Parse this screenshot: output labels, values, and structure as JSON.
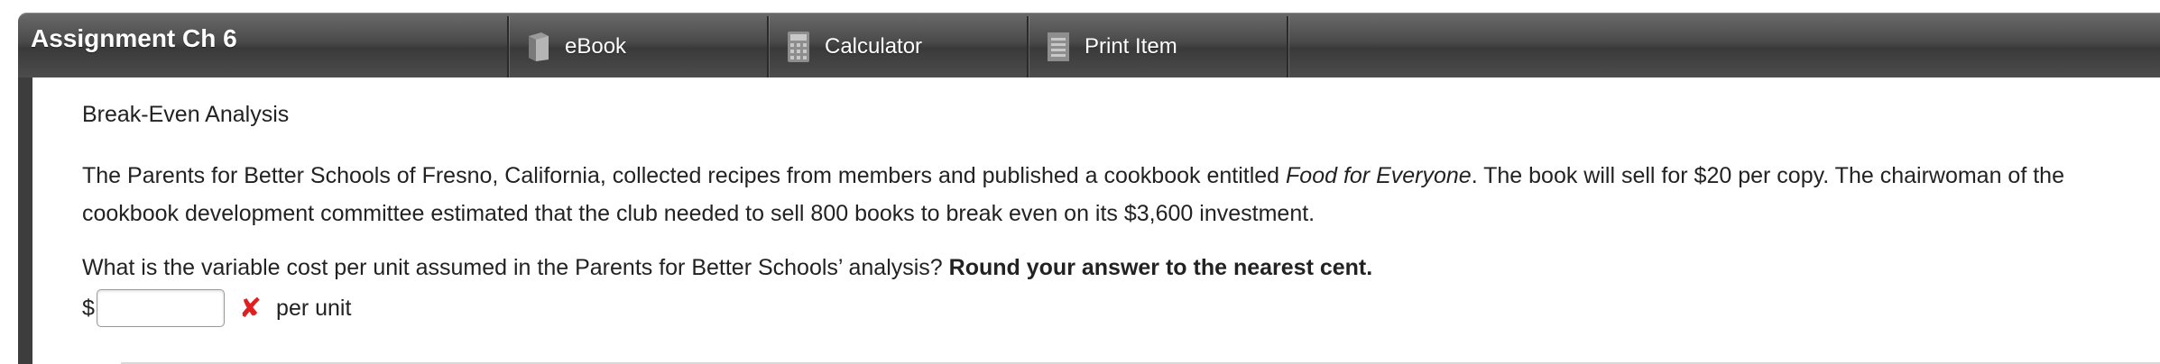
{
  "toolbar": {
    "title": "Assignment Ch 6",
    "buttons": [
      {
        "label": "eBook",
        "icon": "book-icon"
      },
      {
        "label": "Calculator",
        "icon": "calculator-icon"
      },
      {
        "label": "Print Item",
        "icon": "print-icon"
      }
    ]
  },
  "problem": {
    "title": "Break-Even Analysis",
    "para_part1": "The Parents for Better Schools of Fresno, California, collected recipes from members and published a cookbook entitled ",
    "book_title": "Food for Everyone",
    "para_part2": ". The book will sell for $20 per copy. The chairwoman of the cookbook development committee estimated that the club needed to sell 800 books to break even on its $3,600 investment.",
    "question": "What is the variable cost per unit assumed in the Parents for Better Schools’ analysis? ",
    "instruction": "Round your answer to the nearest cent.",
    "currency_symbol": "$",
    "answer_value": "",
    "wrong_mark": "✘",
    "unit_label": "per unit"
  },
  "colors": {
    "toolbar_top": "#6a6a6a",
    "toolbar_bottom": "#3a3a3a",
    "error_red": "#e0201e",
    "text": "#222222"
  }
}
